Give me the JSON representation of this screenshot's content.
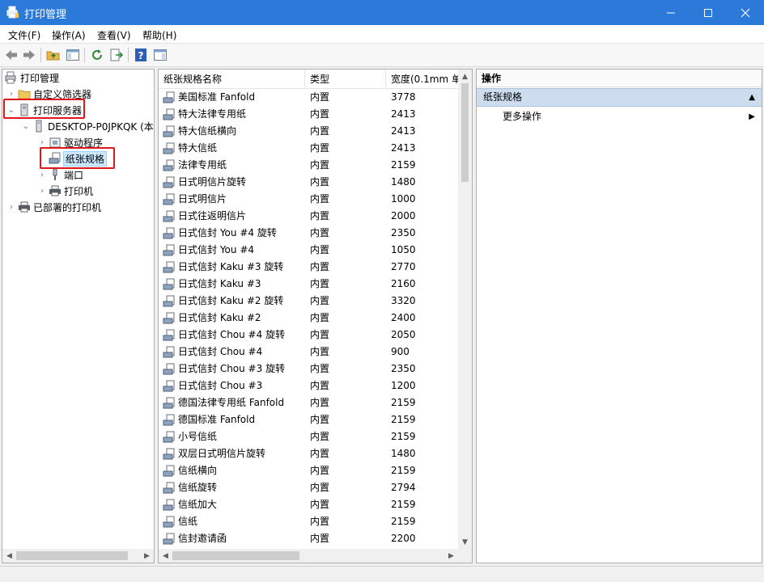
{
  "window": {
    "title": "打印管理",
    "minimize_icon": "minimize-icon",
    "maximize_icon": "maximize-icon",
    "close_icon": "close-icon"
  },
  "menu": [
    "文件(F)",
    "操作(A)",
    "查看(V)",
    "帮助(H)"
  ],
  "toolbar_icons": [
    "back-arrow-icon",
    "forward-arrow-icon",
    "up-folder-icon",
    "show-hide-tree-icon",
    "refresh-icon",
    "export-list-icon",
    "help-icon",
    "show-hide-action-pane-icon"
  ],
  "tree": {
    "root": "打印管理",
    "custom_filters": "自定义筛选器",
    "print_servers": "打印服务器",
    "server": "DESKTOP-P0JPKQK (本",
    "drivers": "驱动程序",
    "forms": "纸张规格",
    "ports": "端口",
    "printers": "打印机",
    "deployed_printers": "已部署的打印机"
  },
  "list": {
    "columns": [
      "纸张规格名称",
      "类型",
      "宽度(0.1mm 单"
    ],
    "rows": [
      [
        "美国标准 Fanfold",
        "内置",
        "3778"
      ],
      [
        "特大法律专用纸",
        "内置",
        "2413"
      ],
      [
        "特大信纸横向",
        "内置",
        "2413"
      ],
      [
        "特大信纸",
        "内置",
        "2413"
      ],
      [
        "法律专用纸",
        "内置",
        "2159"
      ],
      [
        "日式明信片旋转",
        "内置",
        "1480"
      ],
      [
        "日式明信片",
        "内置",
        "1000"
      ],
      [
        "日式往返明信片",
        "内置",
        "2000"
      ],
      [
        "日式信封 You #4 旋转",
        "内置",
        "2350"
      ],
      [
        "日式信封 You #4",
        "内置",
        "1050"
      ],
      [
        "日式信封 Kaku #3 旋转",
        "内置",
        "2770"
      ],
      [
        "日式信封 Kaku #3",
        "内置",
        "2160"
      ],
      [
        "日式信封 Kaku #2 旋转",
        "内置",
        "3320"
      ],
      [
        "日式信封 Kaku #2",
        "内置",
        "2400"
      ],
      [
        "日式信封 Chou #4 旋转",
        "内置",
        "2050"
      ],
      [
        "日式信封 Chou #4",
        "内置",
        "900"
      ],
      [
        "日式信封 Chou #3 旋转",
        "内置",
        "2350"
      ],
      [
        "日式信封 Chou #3",
        "内置",
        "1200"
      ],
      [
        "德国法律专用纸 Fanfold",
        "内置",
        "2159"
      ],
      [
        "德国标准 Fanfold",
        "内置",
        "2159"
      ],
      [
        "小号信纸",
        "内置",
        "2159"
      ],
      [
        "双层日式明信片旋转",
        "内置",
        "1480"
      ],
      [
        "信纸横向",
        "内置",
        "2159"
      ],
      [
        "信纸旋转",
        "内置",
        "2794"
      ],
      [
        "信纸加大",
        "内置",
        "2159"
      ],
      [
        "信纸",
        "内置",
        "2159"
      ],
      [
        "信封邀请函",
        "内置",
        "2200"
      ]
    ]
  },
  "actions": {
    "title": "操作",
    "section": "纸张规格",
    "more": "更多操作"
  }
}
